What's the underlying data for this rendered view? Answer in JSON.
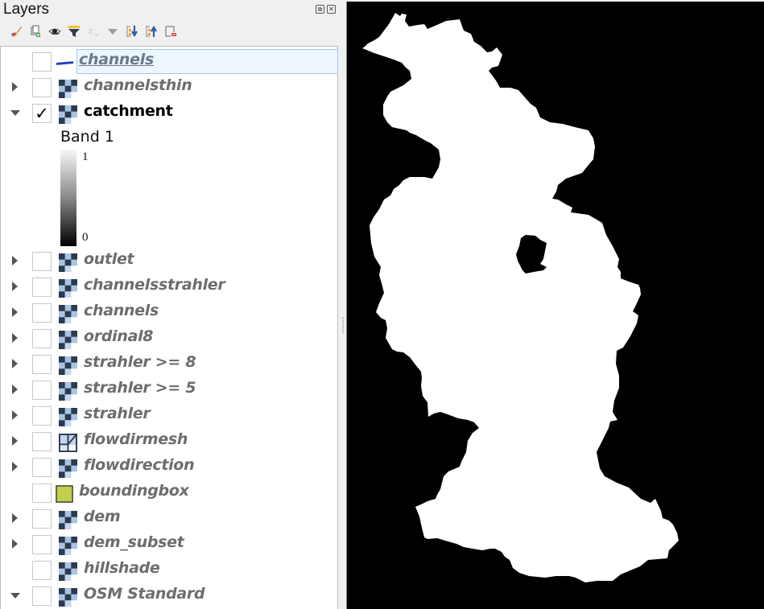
{
  "panel": {
    "title": "Layers",
    "float_icon": "float-icon",
    "close_icon": "close-icon",
    "float_glyph": "⧉",
    "close_glyph": "✕"
  },
  "toolbar": [
    {
      "name": "style-manager-button",
      "icon": "paintbrush-icon"
    },
    {
      "name": "add-group-button",
      "icon": "add-group-icon"
    },
    {
      "name": "visibility-button",
      "icon": "eye-icon"
    },
    {
      "name": "filter-legend-button",
      "icon": "filter-icon"
    },
    {
      "name": "filter-expression-button",
      "icon": "expression-filter-icon",
      "disabled": true
    },
    {
      "name": "filter-dropdown-button",
      "icon": "chevron-down-icon"
    },
    {
      "name": "expand-all-button",
      "icon": "expand-all-icon"
    },
    {
      "name": "collapse-all-button",
      "icon": "collapse-all-icon"
    },
    {
      "name": "remove-layer-button",
      "icon": "remove-layer-icon"
    }
  ],
  "layers": [
    {
      "label": "channels",
      "type": "vector-line",
      "checked": false,
      "expander": "none",
      "editing": true
    },
    {
      "label": "channelsthin",
      "type": "raster",
      "checked": false,
      "expander": "collapsed"
    },
    {
      "label": "catchment",
      "type": "raster",
      "checked": true,
      "expander": "expanded",
      "active": true
    },
    {
      "label": "outlet",
      "type": "raster",
      "checked": false,
      "expander": "collapsed"
    },
    {
      "label": "channelsstrahler",
      "type": "raster",
      "checked": false,
      "expander": "collapsed"
    },
    {
      "label": "channels",
      "type": "raster",
      "checked": false,
      "expander": "collapsed"
    },
    {
      "label": "ordinal8",
      "type": "raster",
      "checked": false,
      "expander": "collapsed"
    },
    {
      "label": "strahler >= 8",
      "type": "raster",
      "checked": false,
      "expander": "collapsed"
    },
    {
      "label": "strahler >= 5",
      "type": "raster",
      "checked": false,
      "expander": "collapsed"
    },
    {
      "label": "strahler",
      "type": "raster",
      "checked": false,
      "expander": "collapsed"
    },
    {
      "label": "flowdirmesh",
      "type": "mesh",
      "checked": false,
      "expander": "collapsed"
    },
    {
      "label": "flowdirection",
      "type": "raster",
      "checked": false,
      "expander": "collapsed"
    },
    {
      "label": "boundingbox",
      "type": "vector-polygon",
      "checked": false,
      "expander": "none"
    },
    {
      "label": "dem",
      "type": "raster",
      "checked": false,
      "expander": "collapsed"
    },
    {
      "label": "dem_subset",
      "type": "raster",
      "checked": false,
      "expander": "collapsed"
    },
    {
      "label": "hillshade",
      "type": "raster",
      "checked": false,
      "expander": "none"
    },
    {
      "label": "OSM Standard",
      "type": "raster",
      "checked": false,
      "expander": "expanded"
    }
  ],
  "legend": {
    "band_label": "Band 1",
    "max": "1",
    "min": "0",
    "ramp_colors": [
      "#ffffff",
      "#000000"
    ]
  },
  "colors": {
    "line_symbol": "#1f3fbf",
    "polygon_fill": "#c0cf4c",
    "polygon_stroke": "#3a3a2a",
    "raster_dark": "#2b3a4e",
    "raster_light": "#a9c3e3",
    "map_background": "#000000",
    "catchment_fill": "#ffffff"
  },
  "map": {
    "description": "catchment raster rendered white on black"
  }
}
